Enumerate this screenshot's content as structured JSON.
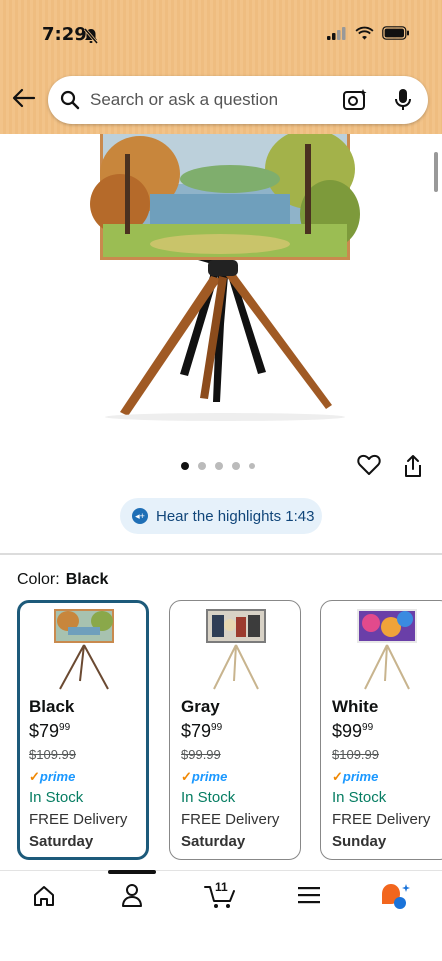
{
  "status": {
    "time": "7:29"
  },
  "search": {
    "placeholder": "Search or ask a question"
  },
  "highlights": {
    "label": "Hear the highlights 1:43"
  },
  "color_selector": {
    "label": "Color:",
    "selected": "Black",
    "options": [
      {
        "name": "Black",
        "price_whole": "$79",
        "price_fraction": "99",
        "list_price": "$109.99",
        "prime": "prime",
        "stock": "In Stock",
        "delivery": "FREE Delivery",
        "day": "Saturday"
      },
      {
        "name": "Gray",
        "price_whole": "$79",
        "price_fraction": "99",
        "list_price": "$99.99",
        "prime": "prime",
        "stock": "In Stock",
        "delivery": "FREE Delivery",
        "day": "Saturday"
      },
      {
        "name": "White",
        "price_whole": "$99",
        "price_fraction": "99",
        "list_price": "$109.99",
        "prime": "prime",
        "stock": "In Stock",
        "delivery": "FREE Delivery",
        "day": "Sunday"
      }
    ]
  },
  "carousel": {
    "dot_count": 5,
    "active_index": 0
  },
  "tabbar": {
    "cart_count": "11"
  },
  "colors": {
    "header": "#f2c389",
    "selected_border": "#1d5a7a",
    "stock_green": "#067d62",
    "prime_blue": "#1a98ff"
  }
}
